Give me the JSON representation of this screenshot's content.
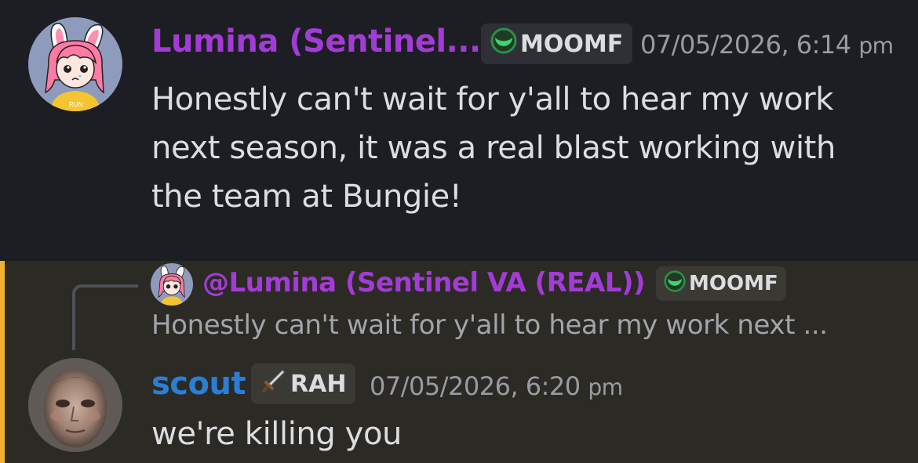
{
  "message1": {
    "avatar_icon": "pink-haired-bunny-girl-avatar",
    "username": "Lumina (Sentinel...",
    "username_color": "#a33bd6",
    "tag_icon": "green-moon-icon",
    "tag_label": "MOOMF",
    "timestamp_date": "07/05/2026, 6:14",
    "timestamp_ampm": "pm",
    "content_lines": [
      "Honestly can't wait for y'all to hear my work",
      "next season, it was a real blast working with",
      "the team at Bungie!"
    ]
  },
  "message2": {
    "reply": {
      "avatar_icon": "pink-haired-bunny-girl-avatar",
      "username": "@Lumina (Sentinel VA (REAL))",
      "tag_icon": "green-moon-icon",
      "tag_label": "MOOMF",
      "preview": "Honestly can't wait for y'all to hear my work next ..."
    },
    "avatar_icon": "scout-face-avatar",
    "username": "scout",
    "username_color": "#2b7ed6",
    "tag_icon": "sword-icon",
    "tag_label": "RAH",
    "timestamp_date": "07/05/2026, 6:20",
    "timestamp_ampm": "pm",
    "content": "we're killing you",
    "mention_highlight_color": "#f0b132"
  }
}
